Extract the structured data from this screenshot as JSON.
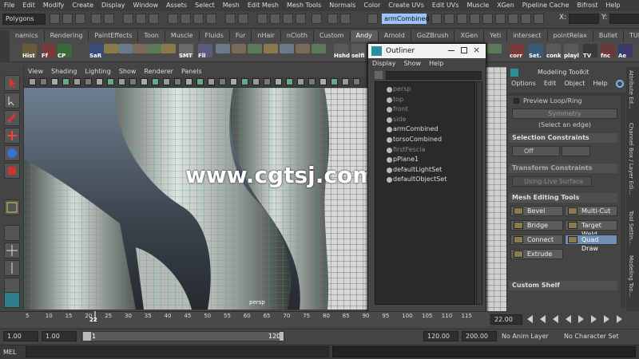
{
  "menubar": [
    "File",
    "Edit",
    "Modify",
    "Create",
    "Display",
    "Window",
    "Assets",
    "Select",
    "Mesh",
    "Edit Mesh",
    "Mesh Tools",
    "Normals",
    "Color",
    "Create UVs",
    "Edit UVs",
    "Muscle",
    "XGen",
    "Pipeline Cache",
    "Bifrost",
    "Help"
  ],
  "status": {
    "mode_select": "Polygons",
    "object_field": "armCombined",
    "x_label": "X:",
    "y_label": "Y:"
  },
  "shelf_tabs": [
    "namics",
    "Rendering",
    "PaintEffects",
    "Toon",
    "Muscle",
    "Fluids",
    "Fur",
    "nHair",
    "nCloth",
    "Custom",
    "Andy",
    "Arnold",
    "GoZBrush",
    "XGen",
    "Yeti",
    "intersect",
    "pointRelax",
    "Bullet",
    "TURTLE"
  ],
  "shelf_active_tab": "Andy",
  "shelf_buttons": [
    {
      "label": "Hist",
      "color": "#6a5a3a"
    },
    {
      "label": "Ff",
      "color": "#7a3a3a"
    },
    {
      "label": "CP",
      "color": "#3a6a3a"
    },
    {
      "label": "SaR",
      "color": "#3a4a7a"
    },
    {
      "label": "SMT",
      "color": "#6a6a6a"
    },
    {
      "label": "Fll",
      "color": "#5a5a7a"
    },
    {
      "label": "Hshd",
      "color": "#5a5a5a"
    },
    {
      "label": "selfi",
      "color": "#5a5a5a"
    },
    {
      "label": "corr",
      "color": "#7a3a3a"
    },
    {
      "label": "Set.",
      "color": "#3a5a7a"
    },
    {
      "label": "conk",
      "color": "#5a5a5a"
    },
    {
      "label": "playl",
      "color": "#5a5a5a"
    },
    {
      "label": "TV",
      "color": "#3a3a3a"
    },
    {
      "label": "fnc",
      "color": "#6a3a3a"
    },
    {
      "label": "Ae",
      "color": "#3a3a6a"
    }
  ],
  "viewport": {
    "menu": [
      "View",
      "Shading",
      "Lighting",
      "Show",
      "Renderer",
      "Panels"
    ],
    "camera_label": "persp",
    "watermark": "www.cgtsj.com"
  },
  "outliner": {
    "title": "Outliner",
    "menu": [
      "Display",
      "Show",
      "Help"
    ],
    "items": [
      {
        "label": "persp",
        "dim": true
      },
      {
        "label": "top",
        "dim": true
      },
      {
        "label": "front",
        "dim": true
      },
      {
        "label": "side",
        "dim": true
      },
      {
        "label": "armCombined",
        "dim": false
      },
      {
        "label": "torsoCombined",
        "dim": false
      },
      {
        "label": "firstFescia",
        "dim": true
      },
      {
        "label": "pPlane1",
        "dim": false
      },
      {
        "label": "defaultLightSet",
        "dim": false
      },
      {
        "label": "defaultObjectSet",
        "dim": false
      }
    ]
  },
  "modeling_toolkit": {
    "title": "Modeling Toolkit",
    "menu": [
      "Options",
      "Edit",
      "Object",
      "Help"
    ],
    "preview_loop": "Preview Loop/Ring",
    "symmetry": "Symmetry",
    "select_edge_hint": "(Select an edge)",
    "selection_constraints": "Selection Constraints",
    "off_label": "Off",
    "transform_constraints": "Transform Constraints",
    "using_live_surface": "Using Live Surface",
    "mesh_editing_tools": "Mesh Editing Tools",
    "tools": [
      {
        "label": "Bevel",
        "active": false
      },
      {
        "label": "Multi-Cut",
        "active": false
      },
      {
        "label": "Bridge",
        "active": false
      },
      {
        "label": "Target Weld",
        "active": false
      },
      {
        "label": "Connect",
        "active": false
      },
      {
        "label": "Quad Draw",
        "active": true
      },
      {
        "label": "Extrude",
        "active": false
      }
    ],
    "custom_shelf": "Custom Shelf"
  },
  "side_tabs": [
    "Attribute Ed...",
    "Channel Box / Layer Edi...",
    "Tool Settin...",
    "Modeling Too..."
  ],
  "timeline": {
    "ticks": [
      "5",
      "10",
      "15",
      "20",
      "25",
      "30",
      "35",
      "40",
      "45",
      "50",
      "55",
      "60",
      "65",
      "70",
      "75",
      "80",
      "85",
      "90",
      "95",
      "100",
      "105",
      "110",
      "115"
    ],
    "current": "22",
    "current_field": "22.00"
  },
  "range": {
    "start": "1.00",
    "start2": "1.00",
    "range_start": "1",
    "range_end": "120",
    "end": "120.00",
    "end2": "200.00",
    "anim_layer": "No Anim Layer",
    "char_set": "No Character Set"
  },
  "mel": {
    "label": "MEL"
  }
}
